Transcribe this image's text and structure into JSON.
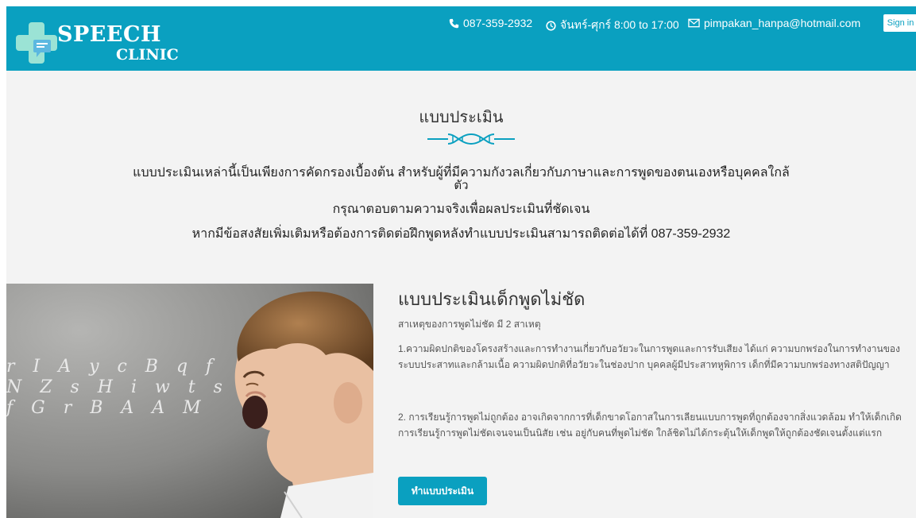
{
  "colors": {
    "brand": "#0aa0c0",
    "section_bg": "#f3f3f3"
  },
  "header": {
    "logo_line1": "SPEECH",
    "logo_line2": "CLINIC",
    "phone": "087-359-2932",
    "hours": "จันทร์-ศุกร์ 8:00 to 17:00",
    "email": "pimpakan_hanpa@hotmail.com",
    "signin_label": "Sign in",
    "icons": [
      "phone-icon",
      "clock-icon",
      "envelope-icon"
    ]
  },
  "intro": {
    "title": "แบบประเมิน",
    "line1": "แบบประเมินเหล่านี้เป็นเพียงการคัดกรองเบื้องต้น สำหรับผู้ที่มีความกังวลเกี่ยวกับภาษาและการพูดของตนเองหรือบุคคลใกล้",
    "line1_wrap": "ตัว",
    "line2": "กรุณาตอบตามความจริงเพื่อผลประเมินที่ชัดเจน",
    "line3": "หากมีข้อสงสัยเพิ่มเติมหรือต้องการติดต่อฝึกพูดหลังทำแบบประเมินสามารถติดต่อได้ที่ 087-359-2932"
  },
  "assessment": {
    "title": "แบบประเมินเด็กพูดไม่ชัด",
    "subtitle": "สาเหตุของการพูดไม่ชัด มี 2 สาเหตุ",
    "para1": "1.ความผิดปกติของโครงสร้างและการทำงานเกี่ยวกับอวัยวะในการพูดและการรับเสียง ได้แก่ ความบกพร่องในการทำงานของระบบประสาทและกล้ามเนื้อ ความผิดปกติที่อวัยวะในช่องปาก บุคคลผู้มีประสาทหูพิการ เด็กที่มีความบกพร่องทางสติปัญญา",
    "para2": "2. การเรียนรู้การพูดไม่ถูกต้อง อาจเกิดจากการที่เด็กขาดโอกาสในการเลียนแบบการพูดที่ถูกต้องจากสิ่งแวดล้อม ทำให้เด็กเกิดการเรียนรู้การพูดไม่ชัดเจนจนเป็นนิสัย เช่น อยู่กับคนที่พูดไม่ชัด ใกล้ชิดไม่ได้กระตุ้นให้เด็กพูดให้ถูกต้องชัดเจนตั้งแต่แรก",
    "button_label": "ทำแบบประเมิน",
    "photo_letters": "r I A y c B q f N Z s H i w t s f G r B A A M"
  }
}
